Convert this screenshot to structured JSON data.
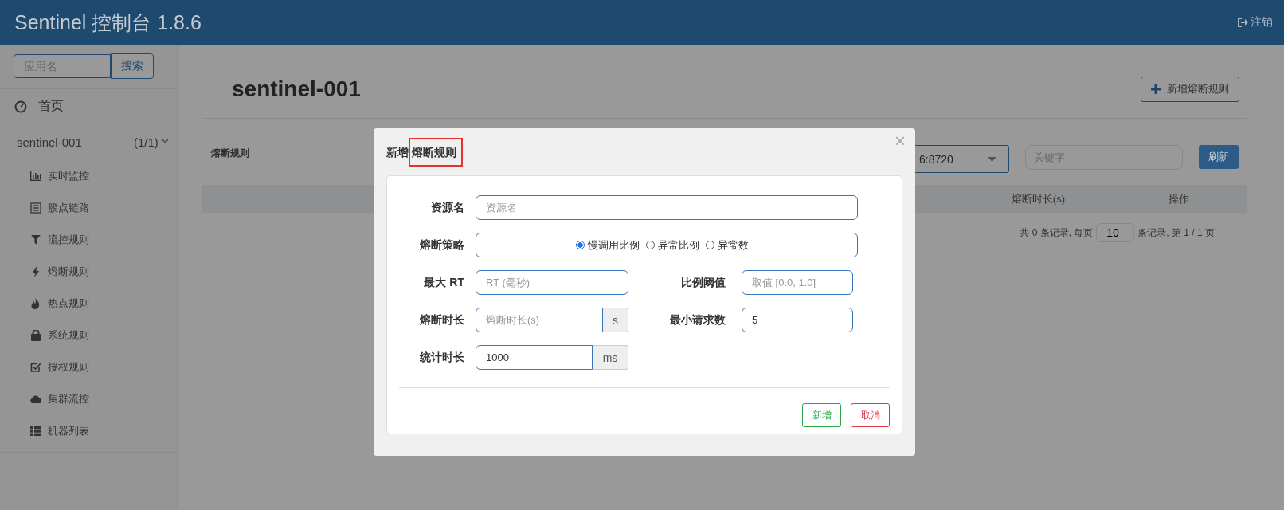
{
  "header": {
    "title": "Sentinel 控制台 1.8.6",
    "logout": "注销"
  },
  "sidebar": {
    "search": {
      "placeholder": "应用名",
      "button": "搜索"
    },
    "home": "首页",
    "app": {
      "name": "sentinel-001",
      "count": "(1/1)",
      "expanded": true
    },
    "items": [
      "实时监控",
      "簇点链路",
      "流控规则",
      "熔断规则",
      "热点规则",
      "系统规则",
      "授权规则",
      "集群流控",
      "机器列表"
    ]
  },
  "page": {
    "title": "sentinel-001",
    "add_button": "新增熔断规则"
  },
  "panel": {
    "title": "熔断规则",
    "machine": "6:8720",
    "keyword_placeholder": "关键字",
    "refresh": "刷新",
    "columns": [
      "熔断时长(s)",
      "操作"
    ],
    "pagination": {
      "prefix": "共 0 条记录, 每页",
      "page_size": "10",
      "suffix": "条记录, 第 1 / 1 页"
    }
  },
  "dialog": {
    "title_prefix": "新增",
    "title_highlight": "熔断规则",
    "close": "×",
    "resource": {
      "label": "资源名",
      "placeholder": "资源名"
    },
    "strategy": {
      "label": "熔断策略",
      "options": [
        {
          "label": "慢调用比例",
          "selected": true
        },
        {
          "label": "异常比例",
          "selected": false
        },
        {
          "label": "异常数",
          "selected": false
        }
      ]
    },
    "max_rt": {
      "label": "最大 RT",
      "placeholder": "RT (毫秒)"
    },
    "ratio": {
      "label": "比例阈值",
      "placeholder": "取值 [0.0, 1.0]"
    },
    "duration": {
      "label": "熔断时长",
      "placeholder": "熔断时长(s)",
      "unit": "s"
    },
    "min_requests": {
      "label": "最小请求数",
      "value": "5"
    },
    "stat_interval": {
      "label": "统计时长",
      "value": "1000",
      "unit": "ms"
    },
    "buttons": [
      {
        "label": "新增",
        "kind": "primary"
      },
      {
        "label": "取消",
        "kind": "cancel"
      }
    ]
  }
}
